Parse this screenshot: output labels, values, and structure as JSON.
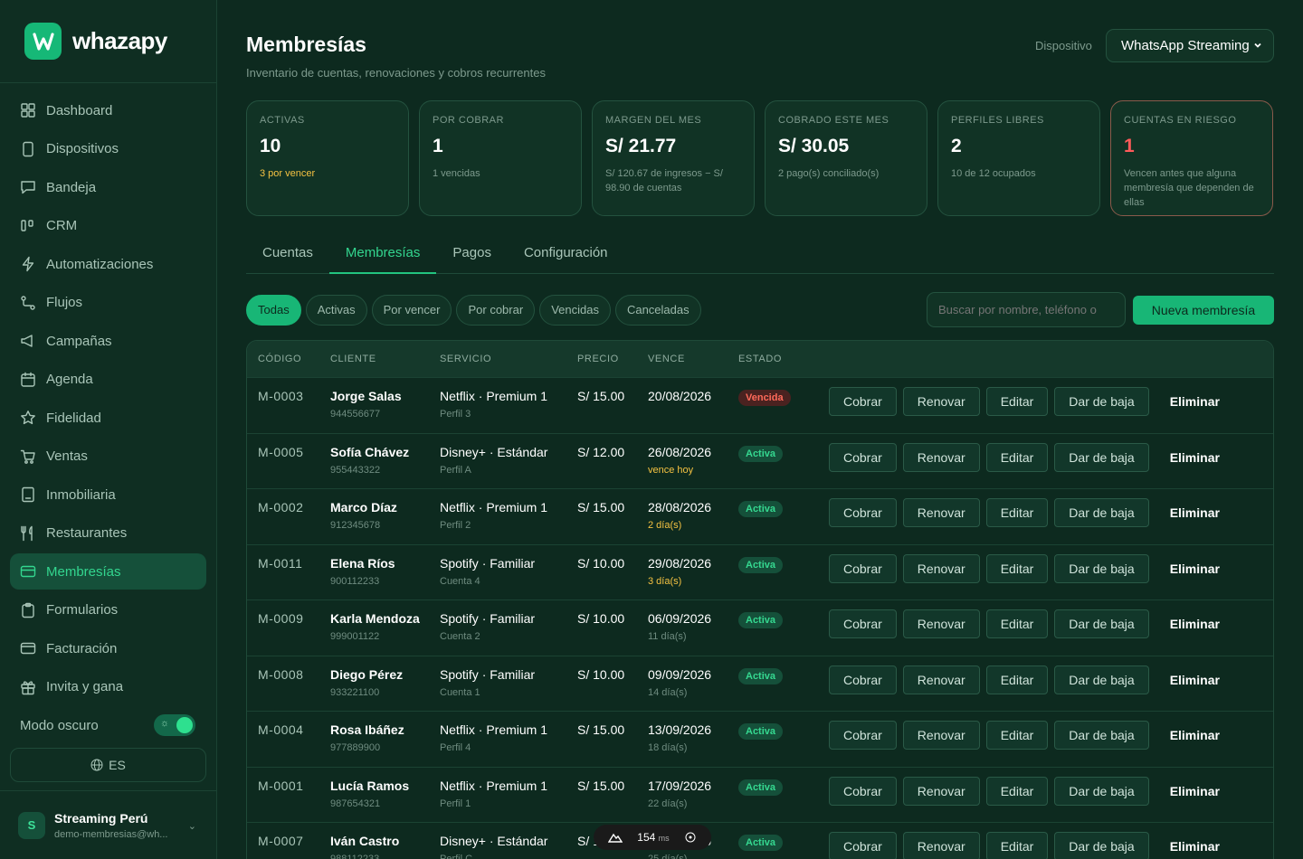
{
  "brand": {
    "name": "whazapy",
    "logo_letter": "W"
  },
  "nav": [
    {
      "icon": "dashboard-icon",
      "label": "Dashboard"
    },
    {
      "icon": "device-icon",
      "label": "Dispositivos"
    },
    {
      "icon": "inbox-icon",
      "label": "Bandeja"
    },
    {
      "icon": "crm-icon",
      "label": "CRM"
    },
    {
      "icon": "bolt-icon",
      "label": "Automatizaciones"
    },
    {
      "icon": "flow-icon",
      "label": "Flujos"
    },
    {
      "icon": "megaphone-icon",
      "label": "Campañas"
    },
    {
      "icon": "calendar-icon",
      "label": "Agenda"
    },
    {
      "icon": "star-icon",
      "label": "Fidelidad"
    },
    {
      "icon": "cart-icon",
      "label": "Ventas"
    },
    {
      "icon": "building-icon",
      "label": "Inmobiliaria"
    },
    {
      "icon": "utensils-icon",
      "label": "Restaurantes"
    },
    {
      "icon": "card-icon",
      "label": "Membresías",
      "active": true
    },
    {
      "icon": "clipboard-icon",
      "label": "Formularios"
    },
    {
      "icon": "invoice-icon",
      "label": "Facturación"
    },
    {
      "icon": "gift-icon",
      "label": "Invita y gana"
    }
  ],
  "dark_mode": {
    "label": "Modo oscuro",
    "on": true
  },
  "lang": {
    "label": "ES"
  },
  "account": {
    "initial": "S",
    "name": "Streaming Perú",
    "email": "demo-membresias@wh..."
  },
  "header": {
    "title": "Membresías",
    "subtitle": "Inventario de cuentas, renovaciones y cobros recurrentes",
    "device_label": "Dispositivo",
    "device_value": "WhatsApp Streaming"
  },
  "stats": [
    {
      "label": "ACTIVAS",
      "value": "10",
      "note": "3 por vencer",
      "note_style": "warn"
    },
    {
      "label": "POR COBRAR",
      "value": "1",
      "note": "1 vencidas"
    },
    {
      "label": "MARGEN DEL MES",
      "value": "S/ 21.77",
      "note": "S/ 120.67 de ingresos − S/ 98.90 de cuentas"
    },
    {
      "label": "COBRADO ESTE MES",
      "value": "S/ 30.05",
      "note": "2 pago(s) conciliado(s)"
    },
    {
      "label": "PERFILES LIBRES",
      "value": "2",
      "note": "10 de 12 ocupados"
    },
    {
      "label": "CUENTAS EN RIESGO",
      "value": "1",
      "note": "Vencen antes que alguna membresía que dependen de ellas",
      "risk": true
    }
  ],
  "tabs": [
    {
      "label": "Cuentas"
    },
    {
      "label": "Membresías",
      "active": true
    },
    {
      "label": "Pagos"
    },
    {
      "label": "Configuración"
    }
  ],
  "filters": [
    {
      "label": "Todas",
      "active": true
    },
    {
      "label": "Activas"
    },
    {
      "label": "Por vencer"
    },
    {
      "label": "Por cobrar"
    },
    {
      "label": "Vencidas"
    },
    {
      "label": "Canceladas"
    }
  ],
  "search": {
    "placeholder": "Buscar por nombre, teléfono o"
  },
  "new_button": "Nueva membresía",
  "table": {
    "columns": [
      "CÓDIGO",
      "CLIENTE",
      "SERVICIO",
      "PRECIO",
      "VENCE",
      "ESTADO"
    ],
    "actions": [
      "Cobrar",
      "Renovar",
      "Editar",
      "Dar de baja",
      "Eliminar"
    ],
    "rows": [
      {
        "code": "M-0003",
        "client": "Jorge Salas",
        "phone": "944556677",
        "service": "Netflix · Premium 1",
        "profile": "Perfil 3",
        "price": "S/ 15.00",
        "due": "20/08/2026",
        "due_note": "",
        "status": "Vencida",
        "status_kind": "bad"
      },
      {
        "code": "M-0005",
        "client": "Sofía Chávez",
        "phone": "955443322",
        "service": "Disney+ · Estándar",
        "profile": "Perfil A",
        "price": "S/ 12.00",
        "due": "26/08/2026",
        "due_note": "vence hoy",
        "due_warn": true,
        "status": "Activa",
        "status_kind": "ok"
      },
      {
        "code": "M-0002",
        "client": "Marco Díaz",
        "phone": "912345678",
        "service": "Netflix · Premium 1",
        "profile": "Perfil 2",
        "price": "S/ 15.00",
        "due": "28/08/2026",
        "due_note": "2 día(s)",
        "due_warn": true,
        "status": "Activa",
        "status_kind": "ok"
      },
      {
        "code": "M-0011",
        "client": "Elena Ríos",
        "phone": "900112233",
        "service": "Spotify · Familiar",
        "profile": "Cuenta 4",
        "price": "S/ 10.00",
        "due": "29/08/2026",
        "due_note": "3 día(s)",
        "due_warn": true,
        "status": "Activa",
        "status_kind": "ok"
      },
      {
        "code": "M-0009",
        "client": "Karla Mendoza",
        "phone": "999001122",
        "service": "Spotify · Familiar",
        "profile": "Cuenta 2",
        "price": "S/ 10.00",
        "due": "06/09/2026",
        "due_note": "11 día(s)",
        "status": "Activa",
        "status_kind": "ok"
      },
      {
        "code": "M-0008",
        "client": "Diego Pérez",
        "phone": "933221100",
        "service": "Spotify · Familiar",
        "profile": "Cuenta 1",
        "price": "S/ 10.00",
        "due": "09/09/2026",
        "due_note": "14 día(s)",
        "status": "Activa",
        "status_kind": "ok"
      },
      {
        "code": "M-0004",
        "client": "Rosa Ibáñez",
        "phone": "977889900",
        "service": "Netflix · Premium 1",
        "profile": "Perfil 4",
        "price": "S/ 15.00",
        "due": "13/09/2026",
        "due_note": "18 día(s)",
        "status": "Activa",
        "status_kind": "ok"
      },
      {
        "code": "M-0001",
        "client": "Lucía Ramos",
        "phone": "987654321",
        "service": "Netflix · Premium 1",
        "profile": "Perfil 1",
        "price": "S/ 15.00",
        "due": "17/09/2026",
        "due_note": "22 día(s)",
        "status": "Activa",
        "status_kind": "ok"
      },
      {
        "code": "M-0007",
        "client": "Iván Castro",
        "phone": "988112233",
        "service": "Disney+ · Estándar",
        "profile": "Perfil C",
        "price": "S/ 12.00",
        "due": "21/09/2026",
        "due_note": "25 día(s)",
        "status": "Activa",
        "status_kind": "ok"
      }
    ]
  },
  "perf_overlay": {
    "value": "154",
    "unit": "ms"
  }
}
